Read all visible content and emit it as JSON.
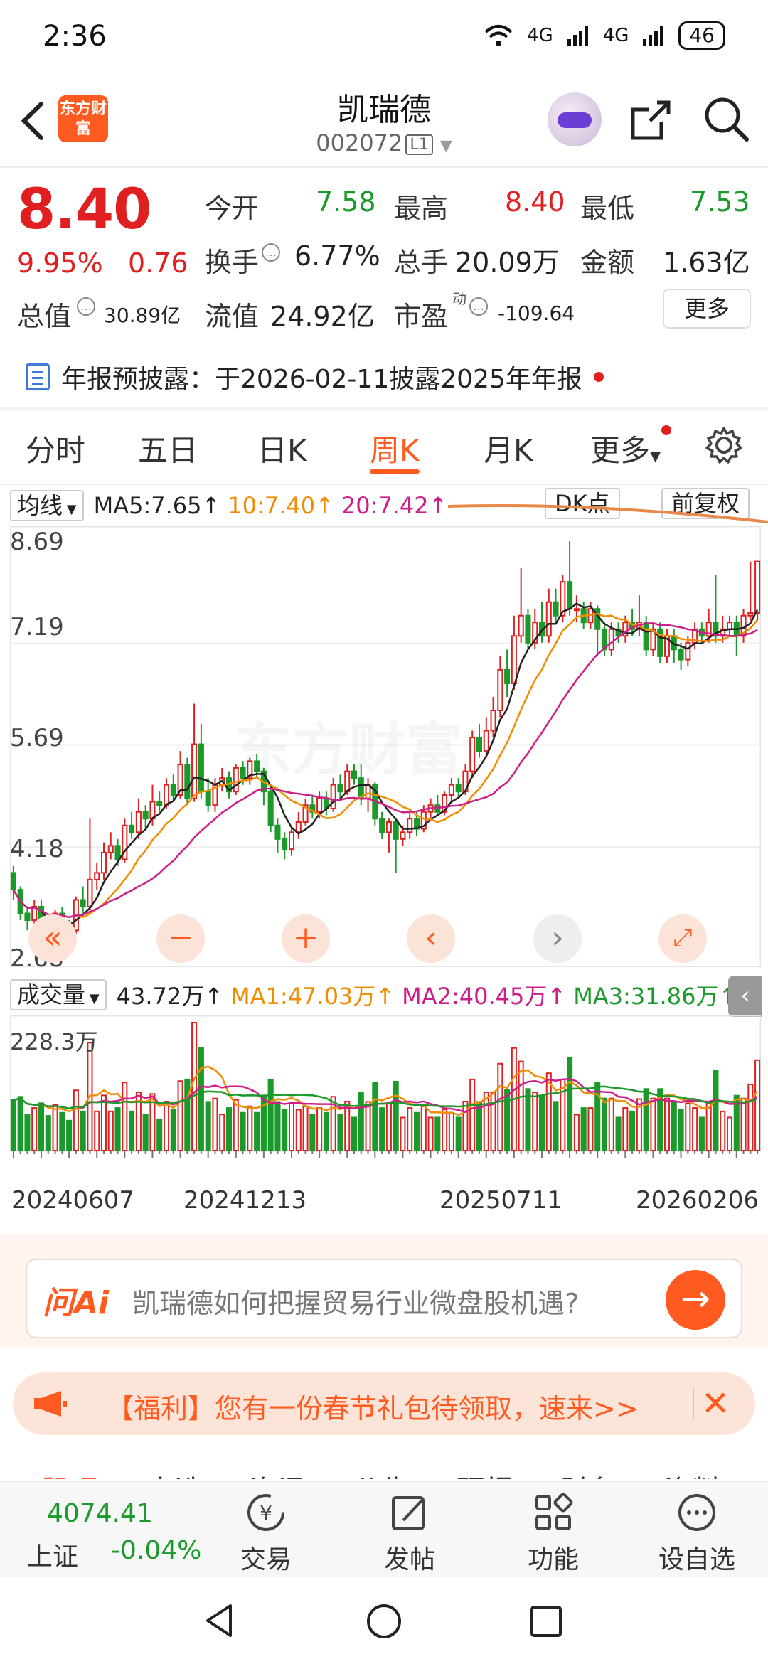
{
  "status_bar": {
    "time": "2:36",
    "signal1": "4G",
    "signal2": "4G",
    "battery": "46"
  },
  "header": {
    "logo": "东方财富",
    "title": "凯瑞德",
    "code": "002072",
    "level": "L1"
  },
  "quote": {
    "price": "8.40",
    "pct": "9.95%",
    "change": "0.76",
    "open_label": "今开",
    "open": "7.58",
    "high_label": "最高",
    "high": "8.40",
    "low_label": "最低",
    "low": "7.53",
    "turnover_label": "换手",
    "turnover": "6.77%",
    "volume_label": "总手",
    "volume": "20.09万",
    "amount_label": "金额",
    "amount": "1.63亿",
    "mktcap_label": "总值",
    "mktcap": "30.89亿",
    "float_label": "流值",
    "float": "24.92亿",
    "pe_label": "市盈",
    "pe_sup": "动",
    "pe": "-109.64",
    "more": "更多"
  },
  "annual": {
    "label": "年报预披露：",
    "text": "于2026-02-11披露2025年年报"
  },
  "tabs": [
    "分时",
    "五日",
    "日K",
    "周K",
    "月K",
    "更多"
  ],
  "active_tab": "周K",
  "ma_row": {
    "selector": "均线",
    "ma5": "MA5:7.65↑",
    "ma10": "10:7.40↑",
    "ma20": "20:7.42↑",
    "dk": "DK点",
    "fuquan": "前复权"
  },
  "y_axis": [
    "8.69",
    "7.19",
    "5.69",
    "4.18",
    "2.68"
  ],
  "watermark": "东方财富",
  "vol_row": {
    "selector": "成交量",
    "vol": "43.72万↑",
    "ma1": "MA1:47.03万↑",
    "ma2": "MA2:40.45万↑",
    "ma3": "MA3:31.86万↑"
  },
  "vol_max": "228.3万",
  "dates": [
    "20240607",
    "20241213",
    "20250711",
    "20260206"
  ],
  "ai": {
    "logo": "问Ai",
    "prompt": "凯瑞德如何把握贸易行业微盘股机遇?"
  },
  "promo": {
    "text": "【福利】您有一份春节礼包待领取，速来>>"
  },
  "sub_tabs": [
    "股吧",
    "自选",
    "资讯",
    "公告",
    "研报",
    "财务",
    "资料"
  ],
  "bottom": {
    "index_value": "4074.41",
    "index_name": "上证",
    "index_pct": "-0.04%",
    "trade": "交易",
    "post": "发帖",
    "func": "功能",
    "watchlist": "设自选"
  },
  "colors": {
    "up": "#e02020",
    "down": "#1a9a2a",
    "accent": "#ff5a1f",
    "ma5": "#222222",
    "ma10": "#f08c00",
    "ma20": "#cc1f8a"
  },
  "chart_data": {
    "type": "candlestick",
    "period": "weekly",
    "y_range": [
      2.68,
      8.69
    ],
    "candles": [
      [
        3.8,
        3.55,
        3.9,
        3.4
      ],
      [
        3.55,
        3.2,
        3.6,
        3.1
      ],
      [
        3.2,
        3.1,
        3.3,
        2.95
      ],
      [
        3.1,
        3.3,
        3.4,
        3.0
      ],
      [
        3.3,
        3.05,
        3.4,
        2.95
      ],
      [
        3.05,
        2.9,
        3.1,
        2.8
      ],
      [
        2.9,
        3.2,
        3.25,
        2.85
      ],
      [
        3.2,
        3.05,
        3.3,
        2.95
      ],
      [
        3.05,
        2.95,
        3.1,
        2.85
      ],
      [
        2.95,
        3.4,
        3.45,
        2.9
      ],
      [
        3.4,
        3.3,
        3.6,
        3.2
      ],
      [
        3.3,
        3.7,
        4.6,
        3.25
      ],
      [
        3.7,
        3.8,
        3.95,
        3.55
      ],
      [
        3.8,
        4.1,
        4.25,
        3.7
      ],
      [
        4.1,
        4.2,
        4.4,
        4.0
      ],
      [
        4.2,
        4.0,
        4.3,
        3.9
      ],
      [
        4.0,
        4.5,
        4.6,
        3.95
      ],
      [
        4.5,
        4.4,
        4.7,
        4.3
      ],
      [
        4.4,
        4.7,
        4.9,
        4.3
      ],
      [
        4.7,
        4.6,
        4.8,
        4.45
      ],
      [
        4.6,
        4.85,
        5.1,
        4.5
      ],
      [
        4.85,
        4.8,
        5.0,
        4.7
      ],
      [
        4.8,
        5.1,
        5.2,
        4.75
      ],
      [
        5.1,
        4.95,
        5.25,
        4.85
      ],
      [
        4.95,
        5.4,
        5.6,
        4.9
      ],
      [
        5.4,
        4.9,
        5.5,
        4.8
      ],
      [
        4.9,
        5.7,
        6.3,
        4.85
      ],
      [
        5.7,
        5.0,
        6.0,
        4.9
      ],
      [
        5.0,
        4.8,
        5.2,
        4.7
      ],
      [
        4.8,
        5.1,
        5.2,
        4.7
      ],
      [
        5.1,
        5.2,
        5.35,
        5.0
      ],
      [
        5.2,
        5.0,
        5.3,
        4.9
      ],
      [
        5.0,
        5.35,
        5.4,
        4.95
      ],
      [
        5.35,
        5.2,
        5.45,
        5.1
      ],
      [
        5.2,
        5.45,
        5.5,
        5.1
      ],
      [
        5.45,
        5.3,
        5.55,
        5.2
      ],
      [
        5.3,
        5.0,
        5.35,
        4.8
      ],
      [
        5.0,
        4.5,
        5.1,
        4.4
      ],
      [
        4.5,
        4.3,
        4.6,
        4.1
      ],
      [
        4.3,
        4.15,
        4.4,
        4.0
      ],
      [
        4.15,
        4.4,
        4.5,
        4.05
      ],
      [
        4.4,
        4.55,
        4.7,
        4.3
      ],
      [
        4.55,
        4.8,
        4.9,
        4.5
      ],
      [
        4.8,
        4.7,
        4.95,
        4.6
      ],
      [
        4.7,
        4.9,
        5.0,
        4.6
      ],
      [
        4.9,
        4.75,
        5.0,
        4.65
      ],
      [
        4.75,
        5.1,
        5.2,
        4.7
      ],
      [
        5.1,
        5.0,
        5.25,
        4.9
      ],
      [
        5.0,
        5.3,
        5.4,
        4.95
      ],
      [
        5.3,
        5.2,
        5.4,
        5.1
      ],
      [
        5.2,
        4.9,
        5.4,
        4.8
      ],
      [
        4.9,
        5.1,
        5.2,
        4.7
      ],
      [
        5.1,
        4.6,
        5.15,
        4.5
      ],
      [
        4.6,
        4.4,
        4.7,
        4.3
      ],
      [
        4.4,
        4.55,
        4.6,
        4.1
      ],
      [
        4.55,
        4.3,
        4.6,
        3.8
      ],
      [
        4.3,
        4.4,
        4.5,
        4.2
      ],
      [
        4.4,
        4.6,
        4.7,
        4.3
      ],
      [
        4.6,
        4.45,
        4.7,
        4.35
      ],
      [
        4.45,
        4.7,
        4.8,
        4.4
      ],
      [
        4.7,
        4.8,
        4.9,
        4.6
      ],
      [
        4.8,
        4.7,
        4.95,
        4.65
      ],
      [
        4.7,
        4.95,
        5.0,
        4.65
      ],
      [
        4.95,
        5.1,
        5.2,
        4.85
      ],
      [
        5.1,
        5.0,
        5.2,
        4.9
      ],
      [
        5.0,
        5.3,
        5.4,
        4.95
      ],
      [
        5.3,
        5.8,
        5.9,
        5.2
      ],
      [
        5.8,
        5.6,
        6.0,
        5.5
      ],
      [
        5.6,
        5.9,
        6.1,
        5.5
      ],
      [
        5.9,
        6.2,
        6.4,
        5.8
      ],
      [
        6.2,
        6.8,
        7.0,
        6.1
      ],
      [
        6.8,
        6.6,
        7.1,
        6.4
      ],
      [
        6.6,
        7.3,
        7.6,
        6.5
      ],
      [
        7.3,
        7.6,
        8.3,
        7.2
      ],
      [
        7.6,
        7.2,
        7.7,
        7.1
      ],
      [
        7.2,
        7.5,
        7.7,
        7.1
      ],
      [
        7.5,
        7.3,
        7.8,
        7.2
      ],
      [
        7.3,
        7.8,
        8.0,
        7.2
      ],
      [
        7.8,
        7.6,
        8.0,
        7.5
      ],
      [
        7.6,
        8.1,
        8.2,
        7.5
      ],
      [
        8.1,
        7.7,
        8.7,
        7.6
      ],
      [
        7.7,
        7.7,
        7.9,
        7.5
      ],
      [
        7.7,
        7.5,
        7.8,
        7.4
      ],
      [
        7.5,
        7.7,
        7.8,
        7.4
      ],
      [
        7.7,
        7.4,
        7.75,
        7.0
      ],
      [
        7.4,
        7.1,
        7.5,
        7.0
      ],
      [
        7.1,
        7.4,
        7.5,
        7.0
      ],
      [
        7.4,
        7.3,
        7.5,
        7.2
      ],
      [
        7.3,
        7.5,
        7.6,
        7.2
      ],
      [
        7.5,
        7.4,
        7.7,
        7.3
      ],
      [
        7.4,
        7.5,
        7.9,
        7.3
      ],
      [
        7.5,
        7.1,
        7.6,
        7.0
      ],
      [
        7.1,
        7.4,
        7.5,
        7.0
      ],
      [
        7.4,
        7.0,
        7.5,
        6.9
      ],
      [
        7.0,
        7.3,
        7.4,
        6.9
      ],
      [
        7.3,
        7.1,
        7.4,
        6.9
      ],
      [
        7.1,
        6.95,
        7.2,
        6.8
      ],
      [
        6.95,
        7.2,
        7.3,
        6.85
      ],
      [
        7.2,
        7.4,
        7.5,
        7.1
      ],
      [
        7.4,
        7.3,
        7.5,
        7.2
      ],
      [
        7.3,
        7.5,
        7.7,
        7.2
      ],
      [
        7.5,
        7.3,
        8.2,
        7.2
      ],
      [
        7.3,
        7.4,
        7.6,
        7.2
      ],
      [
        7.4,
        7.5,
        7.6,
        7.3
      ],
      [
        7.5,
        7.3,
        7.6,
        7.0
      ],
      [
        7.3,
        7.6,
        7.7,
        7.2
      ],
      [
        7.6,
        7.64,
        8.4,
        7.53
      ],
      [
        7.64,
        8.4,
        8.4,
        7.53
      ]
    ],
    "volume_max": 228.3
  }
}
